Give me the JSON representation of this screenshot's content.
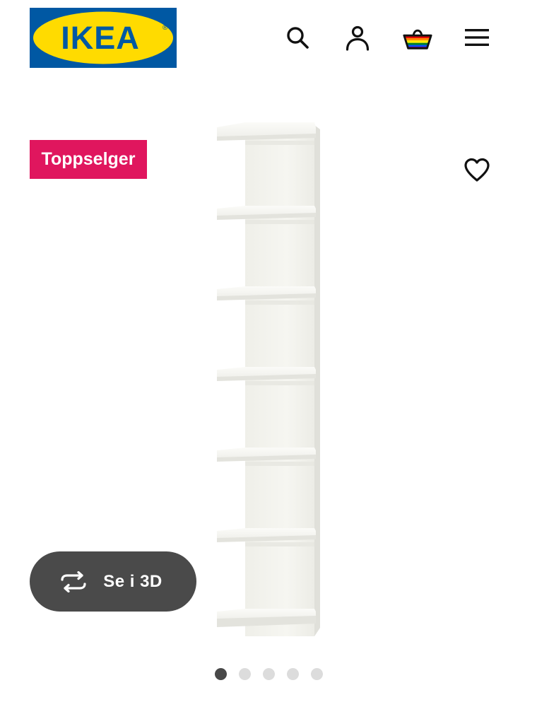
{
  "header": {
    "logo_text": "IKEA",
    "logo_registered_mark": "®",
    "icons": {
      "search": "search-icon",
      "profile": "profile-icon",
      "basket": "shopping-basket-icon",
      "menu": "hamburger-menu-icon"
    }
  },
  "product": {
    "badge_label": "Toppselger",
    "favourite_icon": "heart-icon",
    "image_alt": "",
    "view_3d": {
      "label": "Se i 3D",
      "icon": "rotate-3d-icon"
    }
  },
  "carousel": {
    "slide_count": 5,
    "active_index": 0
  },
  "colors": {
    "brand_blue": "#0058a3",
    "brand_yellow": "#ffdb00",
    "badge_pink": "#e0165e",
    "button_dark": "#4a4a4a",
    "dot_active": "#484848",
    "dot_inactive": "#dcdcdc"
  }
}
